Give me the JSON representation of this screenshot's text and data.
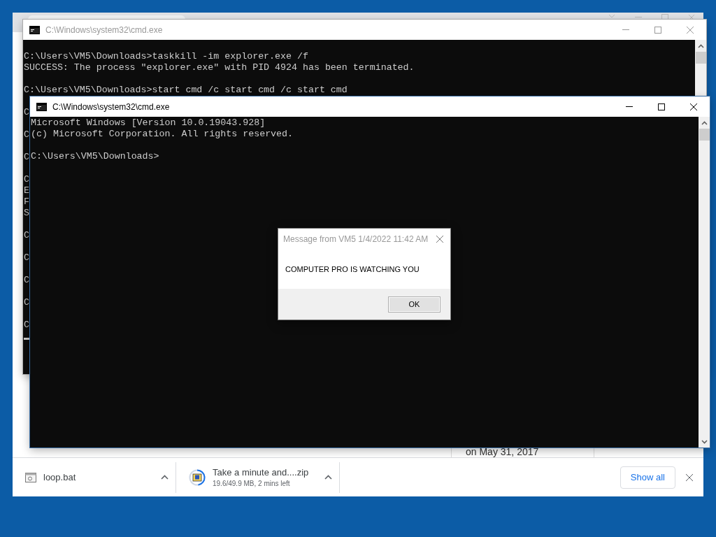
{
  "browser": {
    "content_text": "on May 31, 2017",
    "downloads": [
      {
        "kind": "file",
        "name": "loop.bat"
      },
      {
        "kind": "progress",
        "name": "Take a minute and....zip",
        "status": "19.6/49.9 MB, 2 mins left"
      }
    ],
    "show_all": "Show all"
  },
  "back_console": {
    "title": "C:\\Windows\\system32\\cmd.exe",
    "active": false,
    "lines": [
      {
        "kind": "text",
        "text": "C:\\Users\\VM5\\Downloads>taskkill -im explorer.exe /f"
      },
      {
        "kind": "text",
        "text": "SUCCESS: The process \"explorer.exe\" with PID 4924 has been terminated."
      },
      {
        "kind": "blank"
      },
      {
        "kind": "text",
        "text": "C:\\Users\\VM5\\Downloads>start cmd /c start cmd /c start cmd"
      },
      {
        "kind": "blank"
      },
      {
        "kind": "text",
        "text": "C"
      },
      {
        "kind": "blank"
      },
      {
        "kind": "text",
        "text": "C"
      },
      {
        "kind": "blank"
      },
      {
        "kind": "text",
        "text": "C"
      },
      {
        "kind": "blank"
      },
      {
        "kind": "text",
        "text": "C"
      },
      {
        "kind": "text",
        "text": "E"
      },
      {
        "kind": "text",
        "text": "F"
      },
      {
        "kind": "text",
        "text": "S"
      },
      {
        "kind": "blank"
      },
      {
        "kind": "text",
        "text": "C"
      },
      {
        "kind": "blank"
      },
      {
        "kind": "text",
        "text": "C"
      },
      {
        "kind": "blank"
      },
      {
        "kind": "text",
        "text": "C"
      },
      {
        "kind": "blank"
      },
      {
        "kind": "text",
        "text": "C"
      },
      {
        "kind": "blank"
      },
      {
        "kind": "text",
        "text": "C"
      },
      {
        "kind": "cursor"
      }
    ]
  },
  "front_console": {
    "title": "C:\\Windows\\system32\\cmd.exe",
    "active": true,
    "lines": [
      {
        "kind": "text",
        "text": "Microsoft Windows [Version 10.0.19043.928]"
      },
      {
        "kind": "text",
        "text": "(c) Microsoft Corporation. All rights reserved."
      },
      {
        "kind": "blank"
      },
      {
        "kind": "text",
        "text": "C:\\Users\\VM5\\Downloads>"
      }
    ]
  },
  "message_box": {
    "title": "Message from VM5 1/4/2022 11:42 AM",
    "message": "COMPUTER PRO IS WATCHING YOU",
    "button": "OK"
  }
}
